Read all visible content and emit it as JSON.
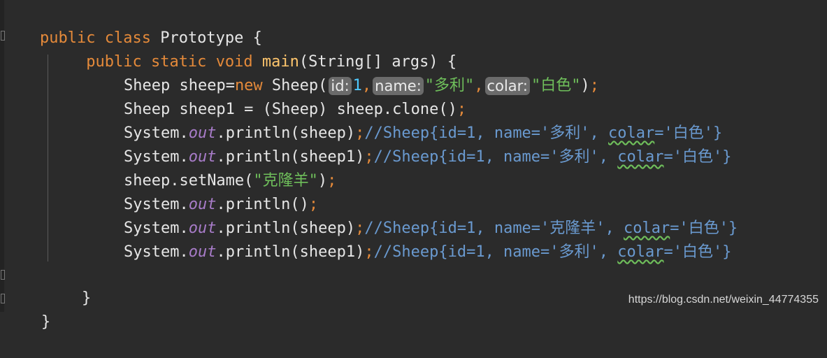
{
  "editor": {
    "lines": [
      {
        "id": "l1",
        "html": "public_class"
      },
      {
        "id": "l2"
      },
      {
        "id": "l3"
      },
      {
        "id": "l4"
      },
      {
        "id": "l5"
      },
      {
        "id": "l6"
      },
      {
        "id": "l7"
      },
      {
        "id": "l8"
      },
      {
        "id": "l9"
      },
      {
        "id": "l10"
      },
      {
        "id": "l11"
      },
      {
        "id": "l12"
      },
      {
        "id": "l13"
      }
    ],
    "tokens": {
      "public": "public",
      "class": "class",
      "static": "static",
      "void": "void",
      "new": "new",
      "classname": "Prototype",
      "main": "main",
      "args_sig": "(String[] args) {",
      "brace_open": " {",
      "brace_close": "}",
      "sheep_type": "Sheep",
      "sheep_decl_a": " sheep=",
      "sheep_ctor": " Sheep(",
      "hint_id": "id:",
      "val_1": "1",
      "comma": ",",
      "hint_name": "name:",
      "str_duoli": "\"多利\"",
      "hint_colar": "colar:",
      "str_baise": "\"白色\"",
      "close_paren": ")",
      "semi": ";",
      "line4_code": "Sheep sheep1 = (Sheep) sheep.clone()",
      "system": "System.",
      "out": "out",
      "println_sheep": ".println(sheep)",
      "println_sheep1": ".println(sheep1)",
      "println_empty": ".println()",
      "comment_a_1": "//Sheep{id=1, name='多利', ",
      "comment_colar": "colar",
      "comment_a_2": "='白色'}",
      "comment_c_1": "//Sheep{id=1, name='克隆羊', ",
      "setname_a": "sheep.setName(",
      "str_kelongyang": "\"克隆羊\"",
      "dots4": "....",
      "dots8": "........"
    }
  },
  "watermark": "https://blog.csdn.net/weixin_44774355"
}
